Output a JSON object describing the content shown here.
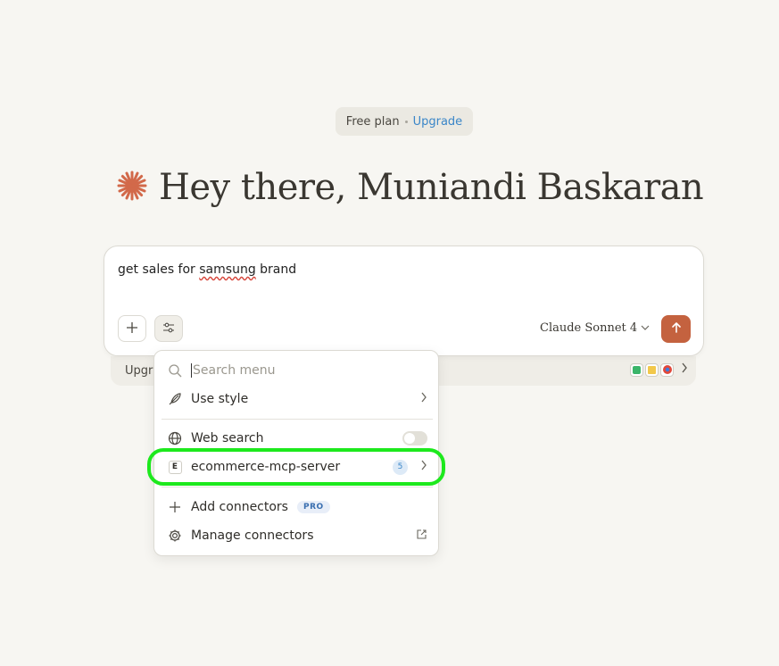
{
  "plan": {
    "label": "Free plan",
    "upgrade_label": "Upgrade"
  },
  "greeting": {
    "text": "Hey there, Muniandi Baskaran"
  },
  "composer": {
    "prompt_before": "get sales for ",
    "prompt_misspelled": "samsung",
    "prompt_after": " brand",
    "model_label": "Claude Sonnet 4",
    "add_icon": "plus-icon",
    "tools_icon": "sliders-icon",
    "send_icon": "arrow-up-icon"
  },
  "banner": {
    "label": "Upgr"
  },
  "menu": {
    "search_placeholder": "Search menu",
    "use_style_label": "Use style",
    "web_search_label": "Web search",
    "web_search_enabled": false,
    "connector_letter": "E",
    "connector_label": "ecommerce-mcp-server",
    "connector_count": "5",
    "add_connectors_label": "Add connectors",
    "pro_badge": "PRO",
    "manage_connectors_label": "Manage connectors"
  },
  "colors": {
    "background": "#f7f6f2",
    "accent": "#c4623f",
    "link": "#3a86c8",
    "highlight": "#1de91d"
  }
}
